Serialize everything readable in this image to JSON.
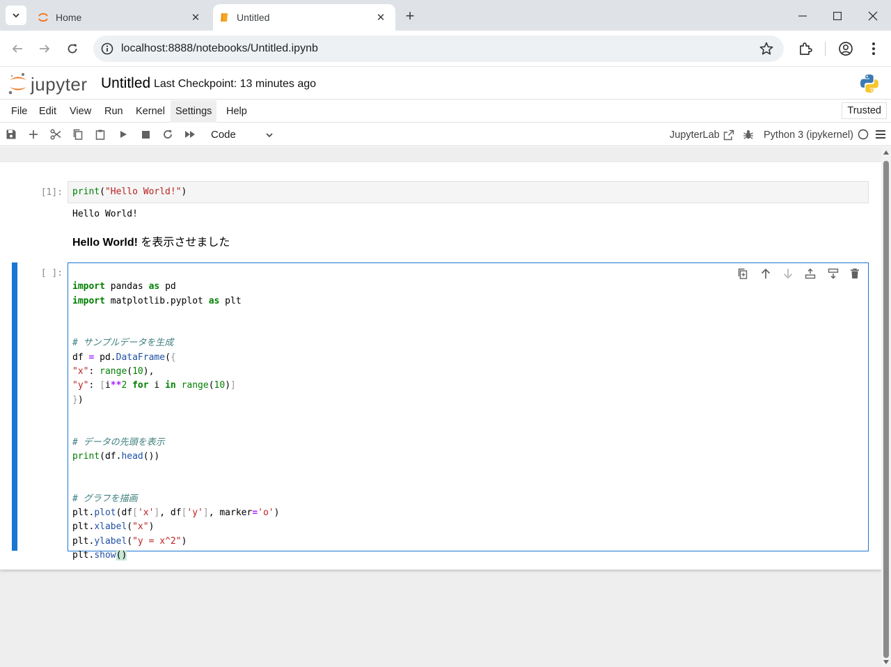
{
  "browser": {
    "tabs": [
      {
        "title": "Home",
        "active": false
      },
      {
        "title": "Untitled",
        "active": true
      }
    ],
    "url": "localhost:8888/notebooks/Untitled.ipynb"
  },
  "header": {
    "logo_text": "jupyter",
    "notebook_title": "Untitled",
    "checkpoint": "Last Checkpoint: 13 minutes ago"
  },
  "menubar": {
    "items": [
      "File",
      "Edit",
      "View",
      "Run",
      "Kernel",
      "Settings",
      "Help"
    ],
    "hovered": "Settings",
    "trusted": "Trusted"
  },
  "toolbar": {
    "cell_type": "Code",
    "jupyterlab_label": "JupyterLab",
    "kernel_name": "Python 3 (ipykernel)"
  },
  "cells": [
    {
      "type": "code",
      "prompt": "[1]:",
      "source": "print(\"Hello World!\")",
      "output": "Hello World!"
    },
    {
      "type": "markdown",
      "bold": "Hello World!",
      "text": " を表示させました"
    },
    {
      "type": "code",
      "prompt": "[ ]:",
      "active": true,
      "lines": [
        "import pandas as pd",
        "import matplotlib.pyplot as plt",
        "",
        "",
        "# サンプルデータを生成",
        "df = pd.DataFrame({",
        "\"x\": range(10),",
        "\"y\": [i**2 for i in range(10)]",
        "})",
        "",
        "",
        "# データの先頭を表示",
        "print(df.head())",
        "",
        "",
        "# グラフを描画",
        "plt.plot(df['x'], df['y'], marker='o')",
        "plt.xlabel(\"x\")",
        "plt.ylabel(\"y = x^2\")",
        "plt.show()"
      ]
    }
  ],
  "colors": {
    "active_cell": "#1976d2",
    "jupyter_orange": "#f37726",
    "keyword": "#008000",
    "string": "#ba2121",
    "comment": "#408080"
  }
}
